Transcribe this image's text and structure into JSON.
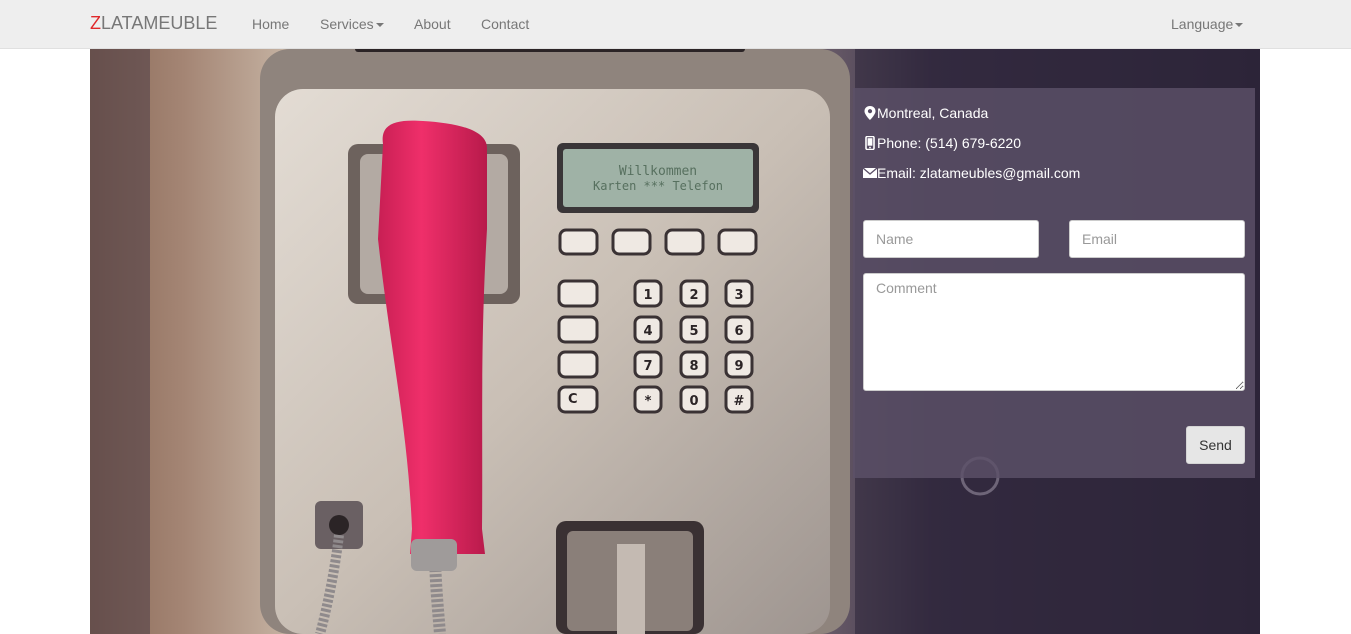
{
  "navbar": {
    "brand_first": "Z",
    "brand_rest": "LATAMEUBLE",
    "links": {
      "home": "Home",
      "services": "Services",
      "about": "About",
      "contact": "Contact",
      "language": "Language"
    }
  },
  "contact": {
    "location": "Montreal, Canada",
    "phone": "Phone: (514) 679-6220",
    "email": "Email: zlatameubles@gmail.com"
  },
  "form": {
    "name_placeholder": "Name",
    "email_placeholder": "Email",
    "comment_placeholder": "Comment",
    "send_label": "Send"
  },
  "hero": {
    "display_text_line1": "Willkommen",
    "display_text_line2": "Karten *** Telefon",
    "keys": [
      "1",
      "2",
      "3",
      "4",
      "5",
      "6",
      "7",
      "8",
      "9",
      "*",
      "0",
      "#",
      "C"
    ]
  },
  "colors": {
    "brand_accent": "#e0292b",
    "navbar_bg": "#eeeeee",
    "panel_bg": "#5c5068",
    "handset": "#e0245e"
  }
}
